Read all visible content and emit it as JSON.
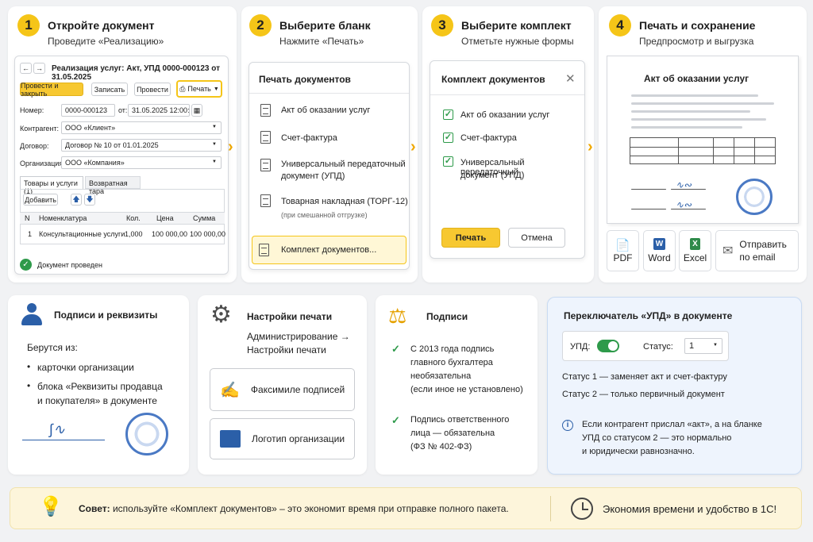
{
  "steps": [
    {
      "num": "1",
      "title": "Откройте документ",
      "sub": "Проведите «Реализацию»"
    },
    {
      "num": "2",
      "title": "Выберите бланк",
      "sub": "Нажмите «Печать»"
    },
    {
      "num": "3",
      "title": "Выберите комплект",
      "sub": "Отметьте нужные формы"
    },
    {
      "num": "4",
      "title": "Печать и сохранение",
      "sub": "Предпросмотр и выгрузка"
    }
  ],
  "doc": {
    "title": "Реализация услуг: Акт, УПД 0000-000123 от 31.05.2025",
    "btn_post_close": "Провести и закрыть",
    "btn_save": "Записать",
    "btn_post": "Провести",
    "btn_print": "Печать",
    "number_label": "Номер:",
    "number": "0000-000123",
    "from_label": "от:",
    "date": "31.05.2025 12:00:00",
    "contractor_label": "Контрагент:",
    "contractor": "ООО «Клиент»",
    "contract_label": "Договор:",
    "contract": "Договор № 10 от 01.01.2025",
    "org_label": "Организация:",
    "org": "ООО «Компания»",
    "tab1": "Товары и услуги (1)",
    "tab2": "Возвратная тара",
    "add": "Добавить",
    "cols": [
      "N",
      "Номенклатура",
      "Кол.",
      "Цена",
      "Сумма"
    ],
    "row": [
      "1",
      "Консультационные услуги",
      "1,000",
      "100 000,00",
      "100 000,00"
    ],
    "status": "Документ проведен"
  },
  "print_menu": {
    "title": "Печать документов",
    "items": [
      "Акт об оказании услуг",
      "Счет-фактура",
      "Универсальный передаточный",
      "документ (УПД)",
      "Товарная накладная (ТОРГ-12)",
      "(при смешанной отгрузке)",
      "Комплект документов..."
    ]
  },
  "kit": {
    "title": "Комплект документов",
    "items": [
      "Акт об оказании услуг",
      "Счет-фактура",
      "Универсальный передаточный",
      "документ (УПД)"
    ],
    "print": "Печать",
    "cancel": "Отмена"
  },
  "preview": {
    "title": "Акт об оказании услуг",
    "exports": [
      "PDF",
      "Word",
      "Excel"
    ],
    "email1": "Отправить",
    "email2": "по email"
  },
  "signatures": {
    "title": "Подписи и реквизиты",
    "from": "Берутся из:",
    "b1": "карточки организации",
    "b2a": "блока «Реквизиты продавца",
    "b2b": "и покупателя» в документе"
  },
  "settings": {
    "title": "Настройки печати",
    "path1": "Администрирование →",
    "path2": "Настройки печати",
    "fax": "Факсимиле подписей",
    "logo": "Логотип организации"
  },
  "signs": {
    "title": "Подписи",
    "p1": [
      "С 2013 года подпись",
      "главного бухгалтера",
      "необязательна",
      "(если иное не установлено)"
    ],
    "p2": [
      "Подпись ответственного",
      "лица — обязательна",
      "(ФЗ № 402-ФЗ)"
    ]
  },
  "upd": {
    "title": "Переключатель «УПД» в документе",
    "label": "УПД:",
    "status_label": "Статус:",
    "status": "1",
    "s1": "Статус 1 — заменяет акт и счет-фактуру",
    "s2": "Статус 2 — только первичный документ",
    "info": [
      "Если контрагент прислал «акт», а на бланке",
      "УПД со статусом 2 — это нормально",
      "и юридически равнозначно."
    ]
  },
  "tip": {
    "bold": "Совет:",
    "text": "используйте «Комплект документов» – это экономит время при отправке полного пакета.",
    "right": "Экономия времени и удобство в 1С!"
  },
  "colors": {
    "accent": "#f5c518",
    "green": "#2e9a4a",
    "blue": "#2b5fa8"
  }
}
